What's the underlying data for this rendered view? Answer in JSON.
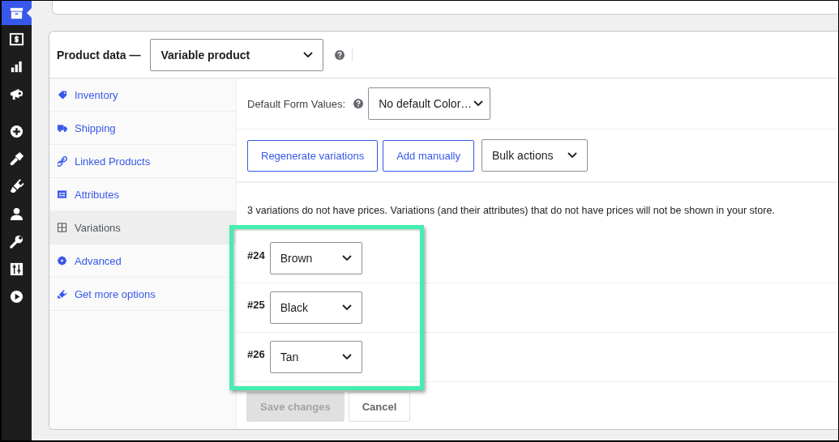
{
  "admin_menu": [
    {
      "selected": true
    },
    {
      "selected": false
    },
    {
      "selected": false
    },
    {
      "selected": false
    },
    {
      "selected": false
    },
    {
      "selected": false
    },
    {
      "selected": false
    },
    {
      "selected": false
    },
    {
      "selected": false
    },
    {
      "selected": false
    },
    {
      "selected": false
    }
  ],
  "product_data": {
    "label": "Product data —",
    "type_select": "Variable product"
  },
  "tabs": [
    {
      "label": "Inventory",
      "selected": false
    },
    {
      "label": "Shipping",
      "selected": false
    },
    {
      "label": "Linked Products",
      "selected": false
    },
    {
      "label": "Attributes",
      "selected": false
    },
    {
      "label": "Variations",
      "selected": true
    },
    {
      "label": "Advanced",
      "selected": false
    },
    {
      "label": "Get more options",
      "selected": false
    }
  ],
  "default_form_values": {
    "label": "Default Form Values:",
    "select": "No default Color…"
  },
  "actions": [
    "Regenerate variations",
    "Add manually"
  ],
  "bulk_actions": "Bulk actions",
  "notice": "3 variations do not have prices. Variations (and their attributes) that do not have prices will not be shown in your store.",
  "variations": [
    {
      "id": "#24",
      "value": "Brown"
    },
    {
      "id": "#25",
      "value": "Black"
    },
    {
      "id": "#26",
      "value": "Tan"
    }
  ],
  "footer_buttons": [
    {
      "label": "Save changes",
      "disabled": true
    },
    {
      "label": "Cancel",
      "disabled": false
    }
  ]
}
